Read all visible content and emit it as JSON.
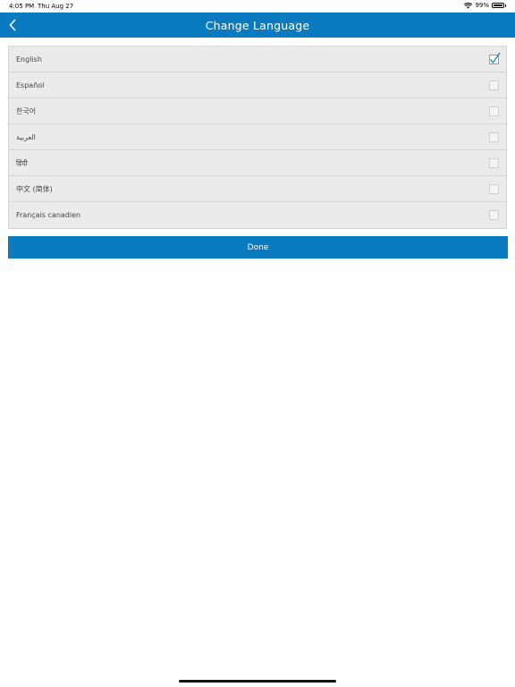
{
  "status_bar": {
    "time": "4:05 PM",
    "date": "Thu Aug 27",
    "battery": "99%",
    "wifi_icon": "wifi-icon",
    "battery_icon": "battery-icon"
  },
  "header": {
    "title": "Change Language",
    "back_icon": "chevron-left-icon",
    "color": "#0b7bc1"
  },
  "languages": [
    {
      "label": "English",
      "checked": true
    },
    {
      "label": "Español",
      "checked": false
    },
    {
      "label": "한국어",
      "checked": false
    },
    {
      "label": "العربية",
      "checked": false
    },
    {
      "label": "हिंदी",
      "checked": false
    },
    {
      "label": "中文 (简体)",
      "checked": false
    },
    {
      "label": "Français canadien",
      "checked": false
    }
  ],
  "done_label": "Done"
}
